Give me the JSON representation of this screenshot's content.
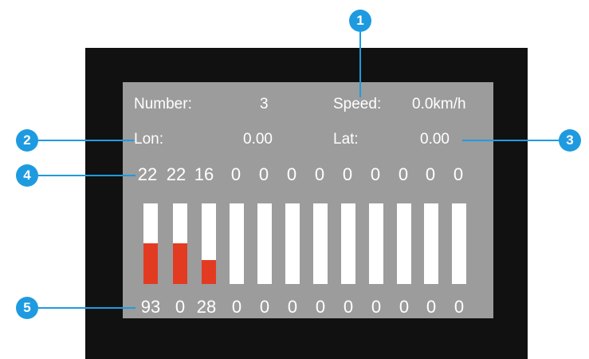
{
  "header": {
    "number_label": "Number:",
    "number_value": "3",
    "speed_label": "Speed:",
    "speed_value": "0.0km/h"
  },
  "position": {
    "lon_label": "Lon:",
    "lon_value": "0.00",
    "lat_label": "Lat:",
    "lat_value": "0.00"
  },
  "snr_values": [
    "22",
    "22",
    "16",
    "0",
    "0",
    "0",
    "0",
    "0",
    "0",
    "0",
    "0",
    "0"
  ],
  "channel_values": [
    "93",
    "0",
    "28",
    "0",
    "0",
    "0",
    "0",
    "0",
    "0",
    "0",
    "0",
    "0"
  ],
  "bars": {
    "fill_fractions": [
      0.51,
      0.51,
      0.3,
      0,
      0,
      0,
      0,
      0,
      0,
      0,
      0,
      0
    ],
    "fill_color": "#e23b22",
    "empty_color": "#ffffff"
  },
  "callouts": [
    "1",
    "2",
    "3",
    "4",
    "5"
  ],
  "colors": {
    "accent": "#1e9be0",
    "screen": "#9c9c9c",
    "frame": "#111111"
  }
}
